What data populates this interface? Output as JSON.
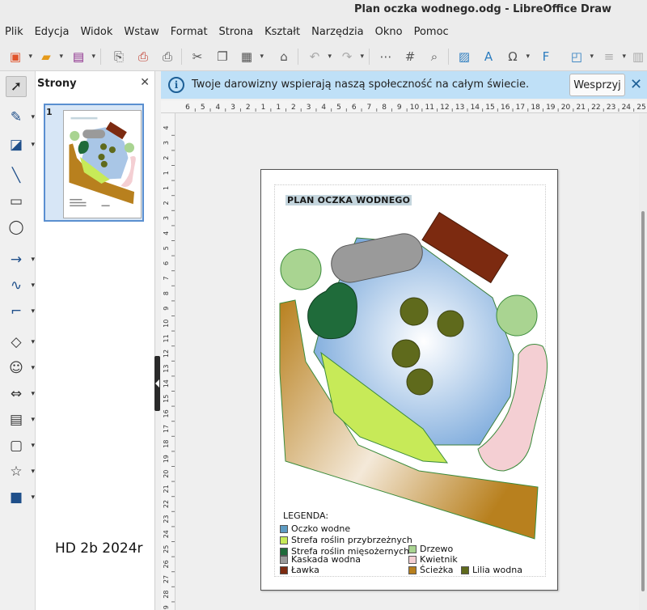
{
  "window": {
    "title": "Plan oczka wodnego.odg - LibreOffice Draw"
  },
  "menu": [
    "Plik",
    "Edycja",
    "Widok",
    "Wstaw",
    "Format",
    "Strona",
    "Kształt",
    "Narzędzia",
    "Okno",
    "Pomoc"
  ],
  "pages_panel": {
    "title": "Strony",
    "page_number": "1",
    "author_note": "HD 2b 2024r"
  },
  "infobar": {
    "message": "Twoje darowizny wspierają naszą społeczność na całym świecie.",
    "button": "Wesprzyj"
  },
  "ruler_h": [
    "6",
    "5",
    "4",
    "3",
    "2",
    "1",
    "1",
    "2",
    "3",
    "4",
    "5",
    "6",
    "7",
    "8",
    "9",
    "10",
    "11",
    "12",
    "13",
    "14",
    "15",
    "16",
    "17",
    "18",
    "19",
    "20",
    "21",
    "22",
    "23",
    "24",
    "25"
  ],
  "ruler_v": [
    "4",
    "3",
    "2",
    "1",
    "1",
    "2",
    "3",
    "4",
    "5",
    "6",
    "7",
    "8",
    "9",
    "10",
    "11",
    "12",
    "13",
    "14",
    "15",
    "16",
    "17",
    "18",
    "19",
    "20",
    "21",
    "22",
    "23",
    "24",
    "25",
    "26",
    "27",
    "28",
    "29"
  ],
  "document": {
    "title": "PLAN OCZKA WODNEGO",
    "legend_title": "LEGENDA:",
    "legend": [
      {
        "label": "Oczko wodne",
        "color": "#5d9bc2"
      },
      {
        "label": "Strefa roślin przybrzeżnych",
        "color": "#c7ea58"
      },
      {
        "label": "Strefa roślin mięsożernych",
        "color": "#1f6b3a"
      },
      {
        "label": "Kaskada wodna",
        "color": "#9a9a9a"
      },
      {
        "label": "Ławka",
        "color": "#7c2a10"
      },
      {
        "label": "Drzewo",
        "color": "#a9d491"
      },
      {
        "label": "Kwietnik",
        "color": "#f4cfd3"
      },
      {
        "label": "Ścieżka",
        "color": "#b8801e"
      },
      {
        "label": "Lilia wodna",
        "color": "#5f6a1c"
      }
    ]
  }
}
